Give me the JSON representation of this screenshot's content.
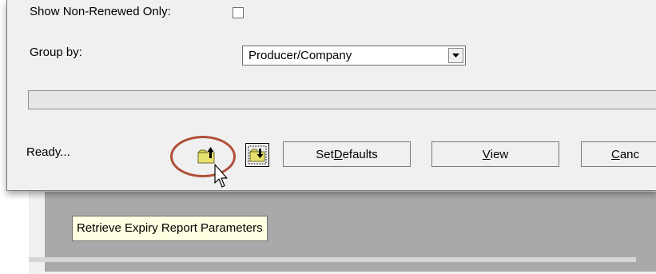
{
  "options": {
    "show_non_renewed_label": "Show Non-Renewed Only:",
    "group_by_label": "Group by:",
    "group_by_value": "Producer/Company"
  },
  "status": {
    "text": "Ready..."
  },
  "buttons": {
    "set_defaults_pre": "Set ",
    "set_defaults_key": "D",
    "set_defaults_post": "efaults",
    "view_key": "V",
    "view_post": "iew",
    "cancel_key": "C",
    "cancel_post": "anc"
  },
  "tooltip": {
    "text": "Retrieve Expiry Report Parameters"
  }
}
